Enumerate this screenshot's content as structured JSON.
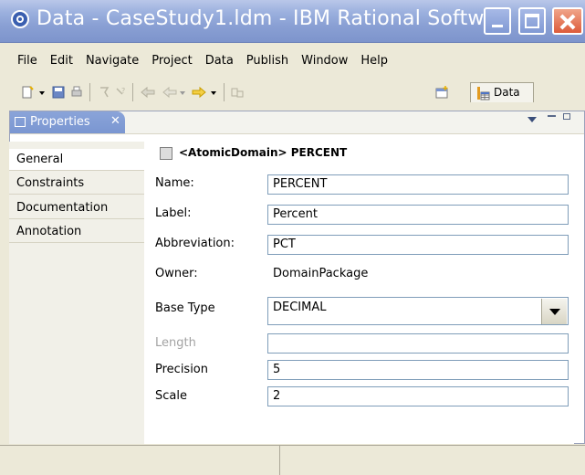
{
  "window": {
    "title": "Data - CaseStudy1.ldm - IBM Rational Softw..."
  },
  "menu": [
    "File",
    "Edit",
    "Navigate",
    "Project",
    "Data",
    "Publish",
    "Window",
    "Help"
  ],
  "toolbar": {
    "perspective_label": "Data"
  },
  "view": {
    "tab_label": "Properties",
    "close_glyph": "✕"
  },
  "side_tabs": [
    "General",
    "Constraints",
    "Documentation",
    "Annotation"
  ],
  "active_tab": "General",
  "form": {
    "header": "<AtomicDomain> PERCENT",
    "name_label": "Name:",
    "name_value": "PERCENT",
    "label_label": "Label:",
    "label_value": "Percent",
    "abbreviation_label": "Abbreviation:",
    "abbreviation_value": "PCT",
    "owner_label": "Owner:",
    "owner_value": "DomainPackage",
    "base_type_label": "Base Type",
    "base_type_value": "DECIMAL",
    "length_label": "Length",
    "length_value": "",
    "precision_label": "Precision",
    "precision_value": "5",
    "scale_label": "Scale",
    "scale_value": "2"
  },
  "colors": {
    "titlebar": "#8aa0d4",
    "close_button": "#dd5b3a",
    "view_tab": "#7a96d1"
  }
}
